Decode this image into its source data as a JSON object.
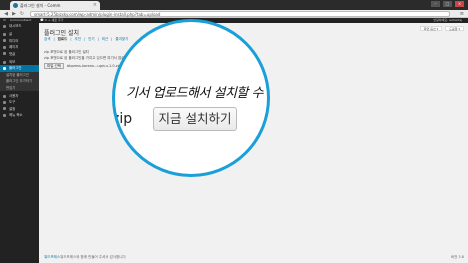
{
  "browser": {
    "tab_title": "플러그인 설치 - Comm",
    "tab_close": "×",
    "back": "◀",
    "forward": "▶",
    "reload": "↻",
    "url": "smart-5.25bizsky.com/wp-admin/plugin-install.php?tab=upload",
    "menu": "≡"
  },
  "adminbar": {
    "wp_logo": "W",
    "site_name": "Communitient",
    "comments": "💬 0",
    "new": "+ 새로 추가",
    "howdy": "안녕하세요, admintsj"
  },
  "sidebar": {
    "items": [
      {
        "label": "대시보드"
      },
      {
        "label": "글"
      },
      {
        "label": "미디어"
      },
      {
        "label": "페이지"
      },
      {
        "label": "댓글"
      },
      {
        "label": "외모"
      },
      {
        "label": "플러그인",
        "active": true
      },
      {
        "label": "설치된 플러그인",
        "sub": true
      },
      {
        "label": "플러그인 추가하기",
        "sub": true
      },
      {
        "label": "편집기",
        "sub": true
      },
      {
        "label": "사용자"
      },
      {
        "label": "도구"
      },
      {
        "label": "설정"
      },
      {
        "label": "메뉴 축소"
      }
    ]
  },
  "main": {
    "screen_options": "화면 옵션 ▾",
    "help": "도움말 ▾",
    "title": "플러그인 설치",
    "subnav": [
      "검색",
      "업로드",
      "추천",
      "인기",
      "최근",
      "즐겨찾기"
    ],
    "desc1": "zip 포맷으로 된 플러그인 설치",
    "desc2": "zip 포맷으로 된 플러그인을 가지고 있으면 여기서 업로드 해서 설치하세요",
    "file_button": "파일 선택",
    "file_name": "bbpress-korean...ugin-v.1.0.zip",
    "footer_text": "워드프레스와 함께 만들어 주셔서 감사합니다",
    "version": "버전 3.8"
  },
  "magnifier": {
    "heading": "기서 업로드해서 설치할 수",
    "zip": "zip",
    "install_button": "지금 설치하기"
  },
  "colors": {
    "accent": "#1a9fd8",
    "sidebar": "#222222",
    "active": "#0074a2"
  }
}
